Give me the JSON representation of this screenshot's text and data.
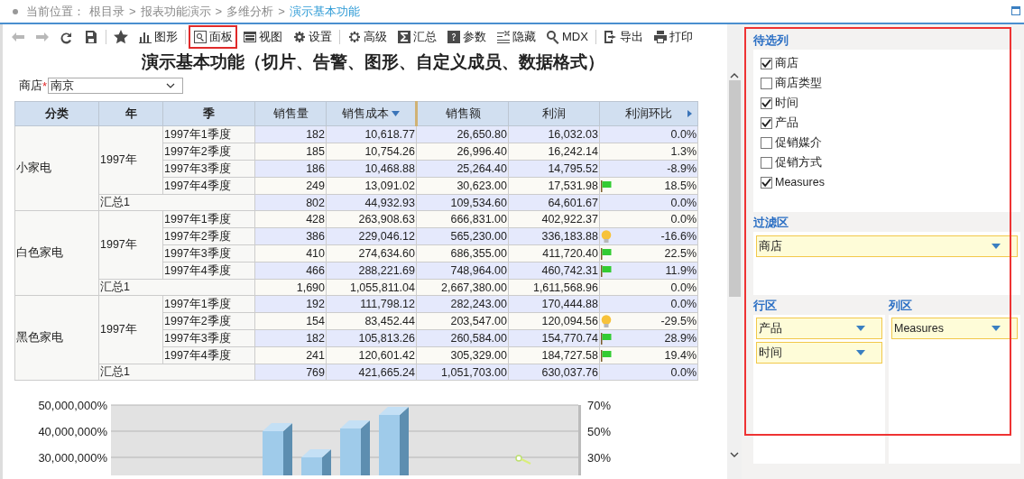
{
  "breadcrumb": {
    "label": "当前位置：",
    "separator": ">",
    "path": [
      "根目录",
      "报表功能演示",
      "多维分析"
    ],
    "current": "演示基本功能"
  },
  "toolbar": [
    {
      "selected": false,
      "disabled": true
    },
    {
      "selected": false,
      "disabled": true
    },
    {
      "selected": false,
      "disabled": false
    },
    {
      "selected": false,
      "disabled": false
    },
    {
      "selected": false,
      "disabled": false
    },
    {
      "label": "图形",
      "selected": false,
      "disabled": false
    },
    {
      "label": "面板",
      "selected": true,
      "disabled": false
    },
    {
      "label": "视图",
      "selected": false,
      "disabled": false
    },
    {
      "label": "设置",
      "selected": false,
      "disabled": false
    },
    {
      "label": "高级",
      "selected": false,
      "disabled": false
    },
    {
      "label": "汇总",
      "selected": false,
      "disabled": false
    },
    {
      "label": "参数",
      "selected": false,
      "disabled": false
    },
    {
      "label": "隐藏",
      "selected": false,
      "disabled": false
    },
    {
      "label": "MDX",
      "selected": false,
      "disabled": false
    },
    {
      "label": "导出",
      "selected": false,
      "disabled": false
    },
    {
      "label": "打印",
      "selected": false,
      "disabled": false
    }
  ],
  "report_title": "演示基本功能（切片、告警、图形、自定义成员、数据格式）",
  "slicer": {
    "label": "商店",
    "required_mark": "*",
    "value": "南京"
  },
  "table": {
    "columns": [
      "分类",
      "年",
      "季",
      "销售量",
      "销售成本",
      "销售额",
      "利润",
      "利润环比"
    ],
    "groups": [
      {
        "category": "小家电",
        "year": "1997年",
        "rows": [
          {
            "quarter": "1997年1季度",
            "values": [
              "182",
              "10,618.77",
              "26,650.80",
              "16,032.03",
              "0.0%"
            ],
            "kind": "plain"
          },
          {
            "quarter": "1997年2季度",
            "values": [
              "185",
              "10,754.26",
              "26,996.40",
              "16,242.14",
              "1.3%"
            ],
            "kind": "plain"
          },
          {
            "quarter": "1997年3季度",
            "values": [
              "186",
              "10,468.88",
              "25,264.40",
              "14,795.52",
              "-8.9%"
            ],
            "kind": "plain"
          },
          {
            "quarter": "1997年4季度",
            "values": [
              "249",
              "13,091.02",
              "30,623.00",
              "17,531.98",
              "18.5%"
            ],
            "kind": "flag"
          }
        ],
        "total": {
          "label": "汇总1",
          "values": [
            "802",
            "44,932.93",
            "109,534.60",
            "64,601.67",
            "0.0%"
          ]
        }
      },
      {
        "category": "白色家电",
        "year": "1997年",
        "rows": [
          {
            "quarter": "1997年1季度",
            "values": [
              "428",
              "263,908.63",
              "666,831.00",
              "402,922.37",
              "0.0%"
            ],
            "kind": "plain"
          },
          {
            "quarter": "1997年2季度",
            "values": [
              "386",
              "229,046.12",
              "565,230.00",
              "336,183.88",
              "-16.6%"
            ],
            "kind": "bulb"
          },
          {
            "quarter": "1997年3季度",
            "values": [
              "410",
              "274,634.60",
              "686,355.00",
              "411,720.40",
              "22.5%"
            ],
            "kind": "flag"
          },
          {
            "quarter": "1997年4季度",
            "values": [
              "466",
              "288,221.69",
              "748,964.00",
              "460,742.31",
              "11.9%"
            ],
            "kind": "flag"
          }
        ],
        "total": {
          "label": "汇总1",
          "values": [
            "1,690",
            "1,055,811.04",
            "2,667,380.00",
            "1,611,568.96",
            "0.0%"
          ]
        }
      },
      {
        "category": "黑色家电",
        "year": "1997年",
        "rows": [
          {
            "quarter": "1997年1季度",
            "values": [
              "192",
              "111,798.12",
              "282,243.00",
              "170,444.88",
              "0.0%"
            ],
            "kind": "plain"
          },
          {
            "quarter": "1997年2季度",
            "values": [
              "154",
              "83,452.44",
              "203,547.00",
              "120,094.56",
              "-29.5%"
            ],
            "kind": "bulb"
          },
          {
            "quarter": "1997年3季度",
            "values": [
              "182",
              "105,813.26",
              "260,584.00",
              "154,770.74",
              "28.9%"
            ],
            "kind": "flag"
          },
          {
            "quarter": "1997年4季度",
            "values": [
              "241",
              "120,601.42",
              "305,329.00",
              "184,727.58",
              "19.4%"
            ],
            "kind": "flag"
          }
        ],
        "total": {
          "label": "汇总1",
          "values": [
            "769",
            "421,665.24",
            "1,051,703.00",
            "630,037.76",
            "0.0%"
          ]
        }
      }
    ]
  },
  "chart": {
    "left_axis_labels": [
      "50,000,000%",
      "40,000,000%",
      "30,000,000%"
    ],
    "right_axis_labels": [
      "70%",
      "50%",
      "30%"
    ]
  },
  "panel": {
    "candidates_title": "待选列",
    "candidates": [
      {
        "label": "商店",
        "checked": true
      },
      {
        "label": "商店类型",
        "checked": false
      },
      {
        "label": "时间",
        "checked": true
      },
      {
        "label": "产品",
        "checked": true
      },
      {
        "label": "促销媒介",
        "checked": false
      },
      {
        "label": "促销方式",
        "checked": false
      },
      {
        "label": "Measures",
        "checked": true
      }
    ],
    "filter_title": "过滤区",
    "filters": [
      "商店"
    ],
    "rows_title": "行区",
    "rows": [
      "产品",
      "时间"
    ],
    "columns_title": "列区",
    "columns": [
      "Measures"
    ]
  }
}
